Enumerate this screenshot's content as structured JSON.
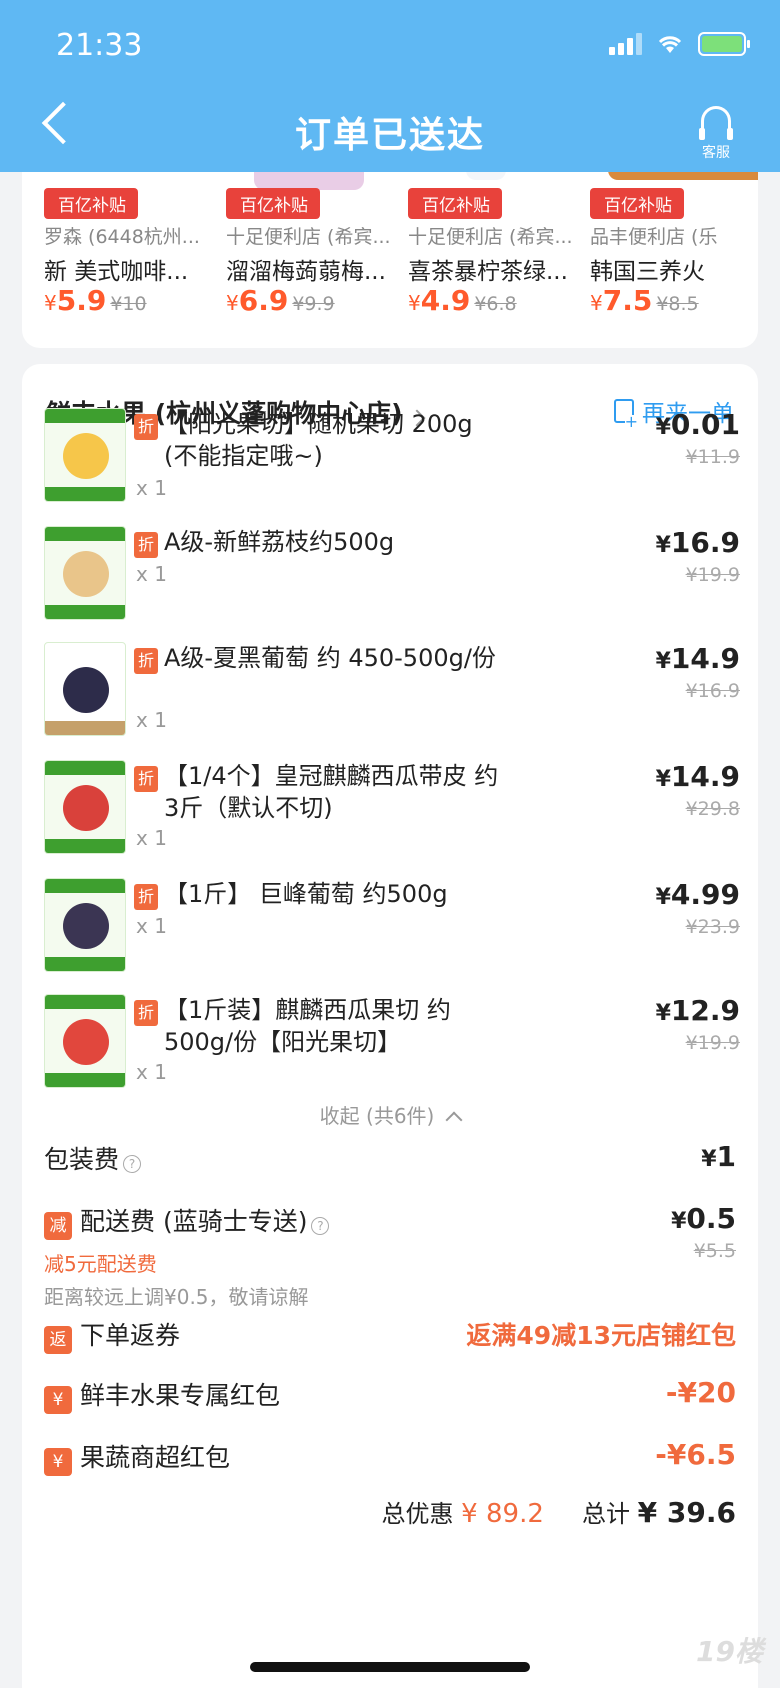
{
  "status": {
    "time": "21:33"
  },
  "header": {
    "title": "订单已送达",
    "service_label": "客服"
  },
  "recommend": [
    {
      "badge": "百亿补贴",
      "shop": "罗森 (6448杭州...",
      "name": "新 美式咖啡...",
      "price": "5.9",
      "old": "¥10"
    },
    {
      "badge": "百亿补贴",
      "shop": "十足便利店 (希宾...",
      "name": "溜溜梅蒟蒻梅...",
      "price": "6.9",
      "old": "¥9.9"
    },
    {
      "badge": "百亿补贴",
      "shop": "十足便利店 (希宾...",
      "name": "喜茶暴柠茶绿...",
      "price": "4.9",
      "old": "¥6.8"
    },
    {
      "badge": "百亿补贴",
      "shop": "品丰便利店 (乐",
      "name": "韩国三养火",
      "price": "7.5",
      "old": "¥8.5"
    }
  ],
  "order": {
    "shop_name": "鲜丰水果 (杭州义蓬购物中心店)",
    "reorder": "再来一单",
    "zhe_tag": "折",
    "items": [
      {
        "name": "【阳光果切】随机果切 200g (不能指定哦~)",
        "qty": "x 1",
        "price": "0.01",
        "old": "¥11.9"
      },
      {
        "name": "A级-新鲜荔枝约500g",
        "qty": "x 1",
        "price": "16.9",
        "old": "¥19.9"
      },
      {
        "name": "A级-夏黑葡萄 约 450-500g/份",
        "qty": "x 1",
        "price": "14.9",
        "old": "¥16.9"
      },
      {
        "name": "【1/4个】皇冠麒麟西瓜带皮 约3斤（默认不切)",
        "qty": "x 1",
        "price": "14.9",
        "old": "¥29.8"
      },
      {
        "name": "【1斤】 巨峰葡萄 约500g",
        "qty": "x 1",
        "price": "4.99",
        "old": "¥23.9"
      },
      {
        "name": "【1斤装】麒麟西瓜果切 约 500g/份【阳光果切】",
        "qty": "x 1",
        "price": "12.9",
        "old": "¥19.9"
      }
    ],
    "collapse": "收起 (共6件)",
    "packing_label": "包装费",
    "packing_value": "1",
    "delivery_tag": "减",
    "delivery_label": "配送费 (蓝骑士专送)",
    "delivery_value": "0.5",
    "delivery_old": "¥5.5",
    "delivery_discount": "减5元配送费",
    "delivery_note": "距离较远上调¥0.5，敬请谅解",
    "return_tag": "返",
    "return_label": "下单返券",
    "return_value": "返满49减13元店铺红包",
    "yen_tag": "¥",
    "redpack1_label": "鲜丰水果专属红包",
    "redpack1_value": "-¥20",
    "redpack2_label": "果蔬商超红包",
    "redpack2_value": "-¥6.5",
    "total_discount_label": "总优惠",
    "total_discount": "¥ 89.2",
    "total_label": "总计",
    "total": "¥ 39.6"
  },
  "currency": "¥",
  "watermark": "19楼",
  "colors": {
    "header": "#5fb8f3",
    "accent_red": "#e8423b",
    "orange": "#f06a3d",
    "blue_link": "#2f9cf0"
  }
}
